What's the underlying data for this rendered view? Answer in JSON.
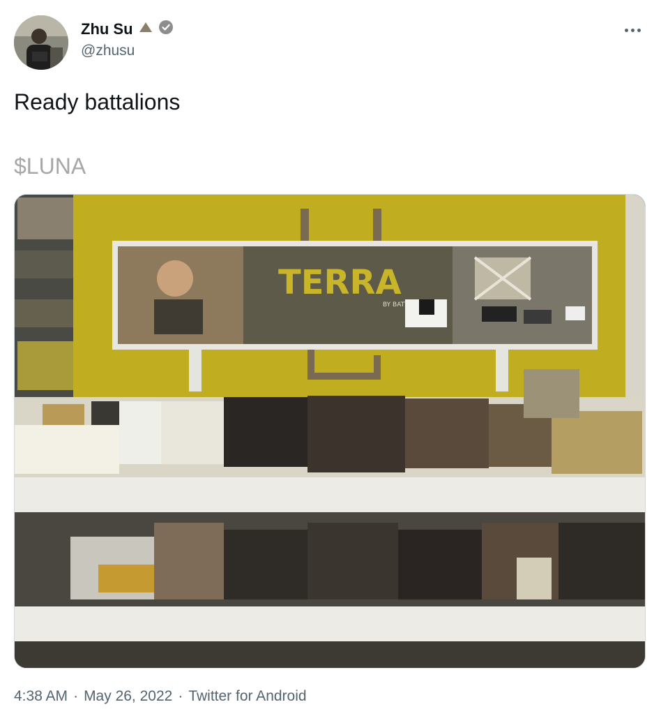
{
  "author": {
    "display_name": "Zhu Su",
    "handle": "@zhusu",
    "badge_icon": "triangle-icon",
    "verified_icon": "verified-badge-icon"
  },
  "tweet": {
    "text": "Ready battalions",
    "cashtag": "$LUNA"
  },
  "media": {
    "sign_text": "TERRA",
    "sign_subtext": "BY BATTAT"
  },
  "meta": {
    "time": "4:38 AM",
    "date": "May 26, 2022",
    "source": "Twitter for Android",
    "separator": "·"
  },
  "colors": {
    "accent_gray": "#536471",
    "cashtag": "#a7a7a7",
    "sign_yellow": "#c8b52a"
  }
}
